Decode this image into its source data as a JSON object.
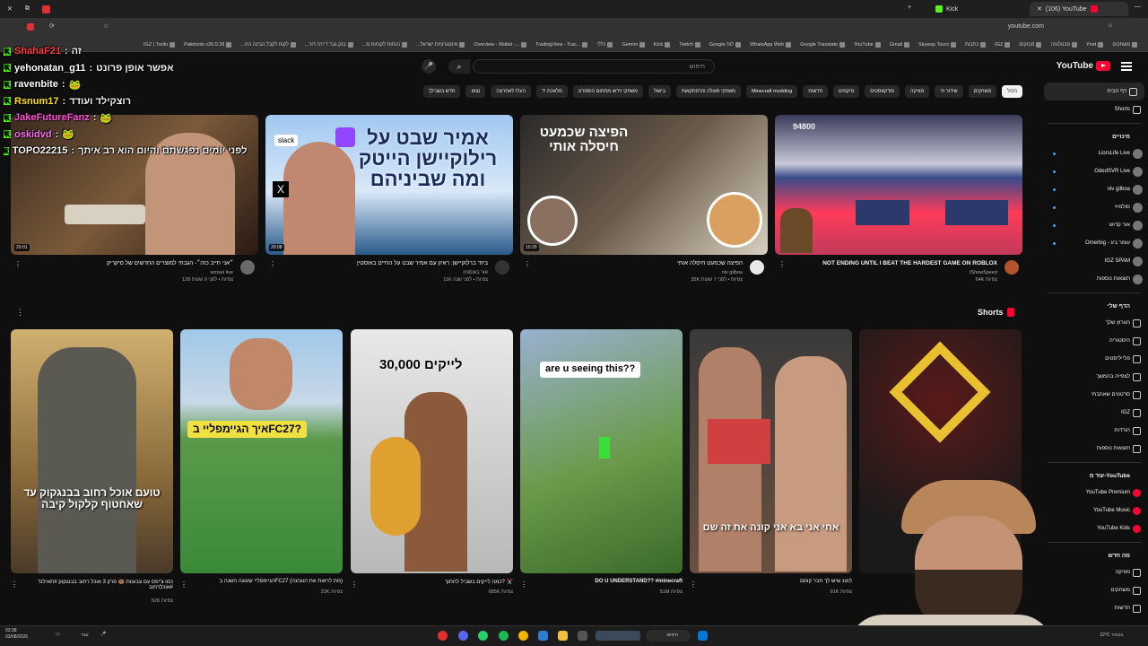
{
  "browser": {
    "tabs": [
      {
        "label": "Kick"
      },
      {
        "label": "(106) YouTube"
      }
    ],
    "url": "youtube.com",
    "bookmarks": [
      "משחקים",
      "Ynet",
      "טכנולוגיה",
      "מבזקים",
      "IGZ",
      "כתבות",
      "Skyway Tours",
      "Gmail",
      "YouTube",
      "Google Translate",
      "WhatsApp Web",
      "Google לוח",
      "Twitch",
      "Kick",
      "Gemini",
      "כללי",
      "TradingView - Trac...",
      "Overview - Wallet -...",
      "...אינטגרציות ישראל",
      "...הנחות לקוחות מ",
      "...בנק גבר דיירה דור",
      "...לקוח לקבל הבינה הח",
      "Paletools v26.0.28",
      "IGZ | Trello"
    ]
  },
  "header": {
    "logo_text": "YouTube",
    "search_placeholder": "חיפוש"
  },
  "chips": [
    "הכול",
    "משחקים",
    "שידור חי",
    "מוזיקה",
    "פודקאסטים",
    "מיקסים",
    "חדשות",
    "Minecraft modding",
    "משחקי פעולה והרפתקאות",
    "בישול",
    "משחקי וידאו מתחום הספורט",
    "מלאכת יד",
    "העלו לאחרונה",
    "נצפו",
    "חדש בשבילך"
  ],
  "sidebar": {
    "main": [
      {
        "label": "דף הבית",
        "icon": "home-icon"
      },
      {
        "label": "Shorts",
        "icon": "shorts-icon"
      }
    ],
    "subs_title": "מינויים",
    "subs": [
      {
        "label": "LiorsLife Live",
        "live": true
      },
      {
        "label": "OdedSVR Live",
        "live": true
      },
      {
        "label": "niv gilboa",
        "live": true
      },
      {
        "label": "סולמיוי",
        "live": true
      },
      {
        "label": "אור קדוש",
        "live": true
      },
      {
        "label": "Omerbig - עומר ביג",
        "live": true
      },
      {
        "label": "IGZ SPAM",
        "live": false
      },
      {
        "label": "תוצאות נוספות",
        "live": false
      }
    ],
    "you_title": "הדף שלי",
    "you": [
      {
        "label": "הערוץ שלך",
        "icon": "channel-icon"
      },
      {
        "label": "היסטוריה",
        "icon": "history-icon"
      },
      {
        "label": "פלייליסטים",
        "icon": "playlist-icon"
      },
      {
        "label": "לצפייה בהמשך",
        "icon": "clock-icon"
      },
      {
        "label": "סרטונים שאהבתי",
        "icon": "like-icon"
      },
      {
        "label": "IGZ",
        "icon": "playlist-icon"
      },
      {
        "label": "הורדות",
        "icon": "download-icon"
      },
      {
        "label": "תוצאות נוספות",
        "icon": "chevron-down-icon"
      }
    ],
    "more_title": "עוד מ-YouTube",
    "more": [
      "YouTube Premium",
      "YouTube Music",
      "YouTube Kids"
    ],
    "explore_title": "מה חדש",
    "explore": [
      "מוזיקה",
      "משחקים",
      "חדשות"
    ]
  },
  "videos": [
    {
      "title": "NOT ENDING UNTIL I BEAT THE HARDEST GAME ON ROBLOX",
      "channel": "IShowSpeed",
      "stats": "64K צפיות",
      "duration": "",
      "overlay": "94800"
    },
    {
      "title": "הפיצה שכמעט חיסלה אותי",
      "channel": "niv gilboa",
      "stats": "35K צפיות • לפני 7 שעות",
      "duration": "10:20",
      "overlay": "הפיצה שכמעט חיסלה אותי"
    },
    {
      "title": "ביזד ברלוקיישן: ראיון עם אמיר שבט על החיים באוסטין",
      "channel": "אור באוסטין",
      "stats": "11K צפיות • לפני שנה",
      "duration": "20:08",
      "overlay": "אמיר שבט על רילוקיישן הייטק ומה שביניהם"
    },
    {
      "title": "״אני חייב כזה״- הגבתי למוצרים החדשים של סיקריק",
      "channel": "sensei live",
      "stats": "128 צפיות • לפני 9 שעות",
      "duration": "20:01",
      "overlay": ""
    }
  ],
  "shorts_title": "Shorts",
  "shorts": [
    {
      "title": "לוטנ שיש לך חבר קוסם",
      "views": "91K צפיות",
      "overlay": "אחי אני בא אני קונה את זה שם"
    },
    {
      "title": "DO U UNDERSTAND?? #minecraft",
      "views": "51M צפיות",
      "overlay": "are u seeing this??"
    },
    {
      "title": "כמה לייקים בשביל לחתוך? ✂️",
      "views": "685K צפיות",
      "overlay": "30,000 לייקים"
    },
    {
      "title": "הגיימפליי שעוגה השנה בFC27 (מת לראות את הוגהנה)",
      "views": "22K צפיות",
      "overlay": "איך הגיימפליי בFC27?"
    },
    {
      "title": "כמו צ'יפס עם צבעוות 🍩 פרק 3 אוכל רחוב בבנגקוק #תאילנד #אוכלרחוב",
      "views": "52K צפיות",
      "overlay": "טועם אוכל רחוב בבנגקוק עד שאחטוף קלקול קיבה"
    }
  ],
  "chat": [
    {
      "user": "ShahaF21",
      "msg": "זה",
      "color": "#ff3b3b"
    },
    {
      "user": "yehonatan_g11",
      "msg": "אפשר אופן פרונט",
      "color": "#ffffff"
    },
    {
      "user": "ravenbite",
      "msg": "🐸",
      "color": "#ffffff"
    },
    {
      "user": "Rsnum17",
      "msg": "רוצקילד ועודד",
      "color": "#ffe100"
    },
    {
      "user": "JakeFutureFanz",
      "msg": "🐸",
      "color": "#ff4ed8"
    },
    {
      "user": "oskidvd",
      "msg": "🐸",
      "color": "#ff6ef0"
    },
    {
      "user": "TOPO22215",
      "msg": "לפני יומים נפגשתם והיום הוא רב איתך",
      "color": "#ffffff"
    }
  ],
  "taskbar": {
    "time": "03:38",
    "date": "03/08/2026",
    "search_placeholder": "חיפוש",
    "lang": "עבר",
    "weather": "22°C בבהיר"
  }
}
